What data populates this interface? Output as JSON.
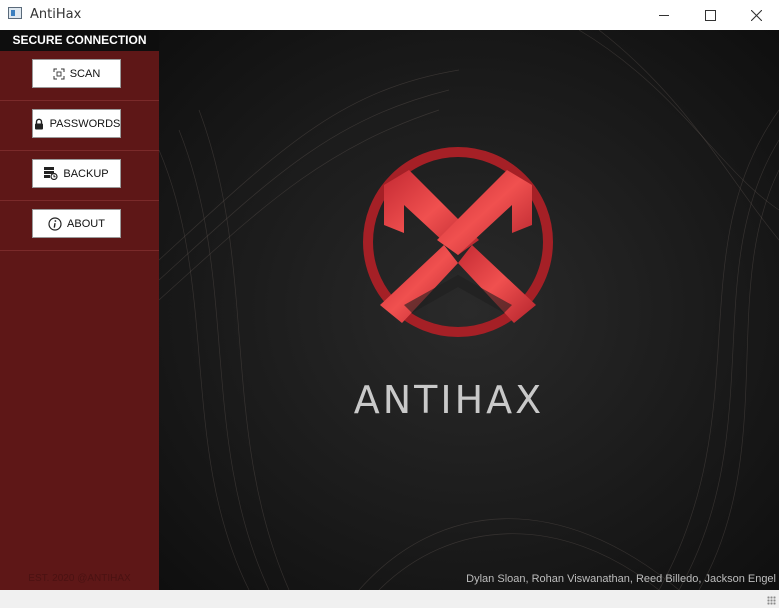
{
  "window": {
    "title": "AntiHax",
    "controls": {
      "minimize": "minimize",
      "maximize": "maximize",
      "close": "close"
    }
  },
  "sidebar": {
    "header": "SECURE CONNECTION",
    "items": [
      {
        "label": "SCAN",
        "icon": "scan-icon"
      },
      {
        "label": "PASSWORDS",
        "icon": "lock-icon"
      },
      {
        "label": "BACKUP",
        "icon": "backup-icon"
      },
      {
        "label": "ABOUT",
        "icon": "info-icon"
      }
    ],
    "footer": "EST. 2020 @ANTIHAX"
  },
  "main": {
    "brand": "ANTIHAX",
    "credits": "Dylan Sloan, Rohan Viswanathan, Reed Billedo, Jackson Engel"
  },
  "colors": {
    "sidebar": "#5e1717",
    "header": "#0e0e0e",
    "main_bg": "#1a1a1a",
    "logo_red": "#d7353c"
  }
}
